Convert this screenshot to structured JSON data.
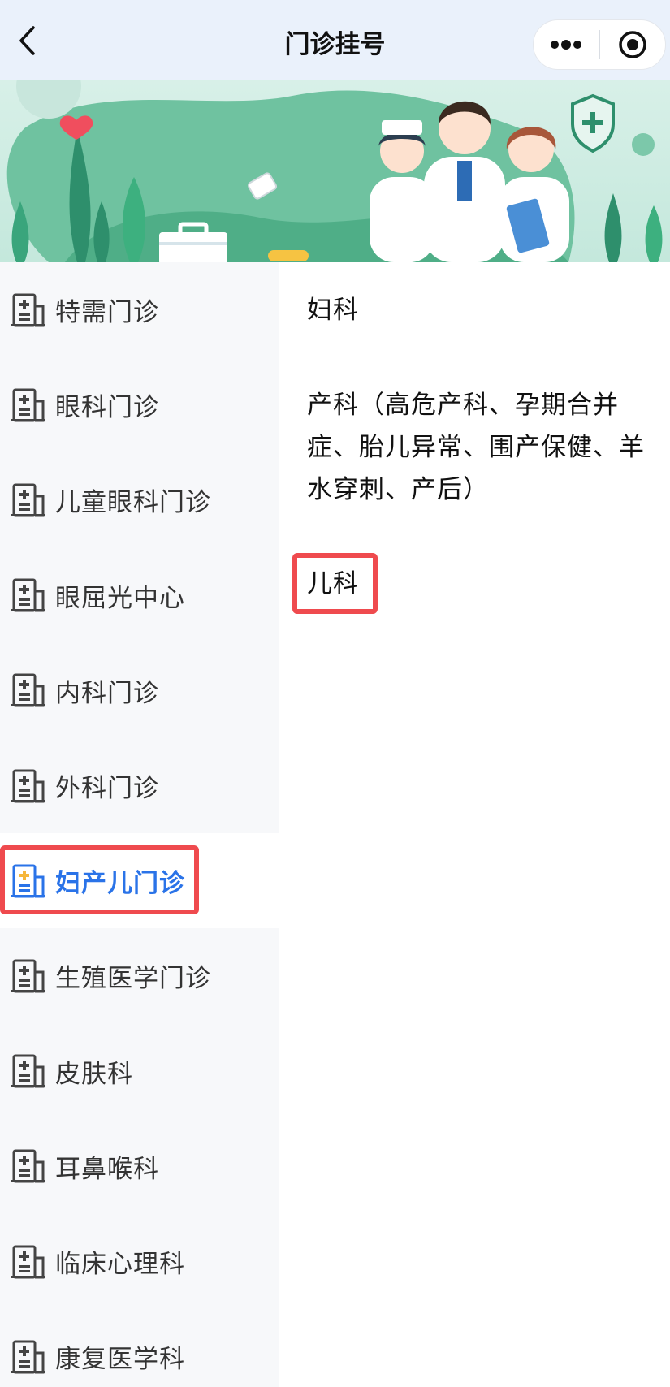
{
  "navbar": {
    "title": "门诊挂号",
    "back_icon": "chevron-left-icon",
    "more_icon": "more-dots-icon",
    "close_icon": "target-circle-icon"
  },
  "banner": {
    "description_icons": [
      "heart-icon",
      "pill-icon",
      "shield-plus-icon",
      "medical-kit-icon"
    ]
  },
  "sidebar": {
    "items": [
      {
        "label": "特需门诊"
      },
      {
        "label": "眼科门诊"
      },
      {
        "label": "儿童眼科门诊"
      },
      {
        "label": "眼屈光中心"
      },
      {
        "label": "内科门诊"
      },
      {
        "label": "外科门诊"
      },
      {
        "label": "妇产儿门诊",
        "active": true
      },
      {
        "label": "生殖医学门诊"
      },
      {
        "label": "皮肤科"
      },
      {
        "label": "耳鼻喉科"
      },
      {
        "label": "临床心理科"
      },
      {
        "label": "康复医学科"
      }
    ],
    "active_color": "#2a73e8",
    "icon": "hospital-building-icon"
  },
  "content": {
    "items": [
      {
        "label": "妇科"
      },
      {
        "label": "产科（高危产科、孕期合并症、胎儿异常、围产保健、羊水穿刺、产后）"
      },
      {
        "label": "儿科"
      }
    ]
  },
  "colors": {
    "highlight_border": "#ef4a4e",
    "navbar_bg": "#eaf1fb",
    "sidebar_bg": "#f7f8fa"
  }
}
